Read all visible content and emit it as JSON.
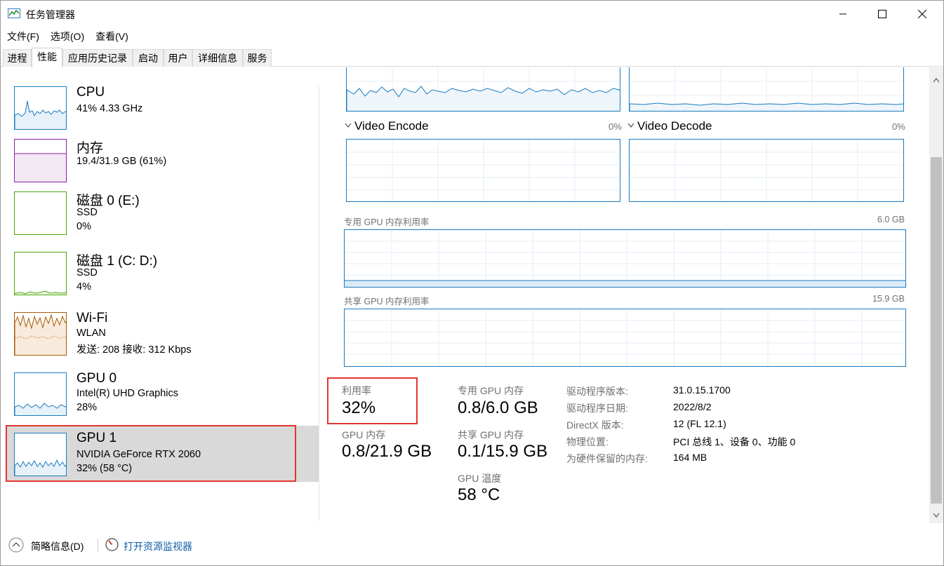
{
  "window": {
    "title": "任务管理器"
  },
  "menu": [
    "文件(F)",
    "选项(O)",
    "查看(V)"
  ],
  "tabs": [
    "进程",
    "性能",
    "应用历史记录",
    "启动",
    "用户",
    "详细信息",
    "服务"
  ],
  "sidebar": {
    "items": [
      {
        "title": "CPU",
        "line1": "41%  4.33 GHz",
        "line2": ""
      },
      {
        "title": "内存",
        "line1": "19.4/31.9 GB (61%)",
        "line2": ""
      },
      {
        "title": "磁盘 0 (E:)",
        "line1": "SSD",
        "line2": "0%"
      },
      {
        "title": "磁盘 1 (C: D:)",
        "line1": "SSD",
        "line2": "4%"
      },
      {
        "title": "Wi-Fi",
        "line1": "WLAN",
        "line2": "发送: 208 接收: 312 Kbps"
      },
      {
        "title": "GPU 0",
        "line1": "Intel(R) UHD Graphics",
        "line2": "28%"
      },
      {
        "title": "GPU 1",
        "line1": "NVIDIA GeForce RTX 2060",
        "line2": "32%  (58 °C)"
      }
    ]
  },
  "engines": {
    "encode": {
      "label": "Video Encode",
      "pct": "0%"
    },
    "decode": {
      "label": "Video Decode",
      "pct": "0%"
    }
  },
  "memory_graphs": {
    "dedicated": {
      "label": "专用 GPU 内存利用率",
      "max": "6.0 GB"
    },
    "shared": {
      "label": "共享 GPU 内存利用率",
      "max": "15.9 GB"
    }
  },
  "stats": {
    "utilization_label": "利用率",
    "utilization": "32%",
    "gpu_mem_label": "GPU 内存",
    "gpu_mem": "0.8/21.9 GB",
    "dedicated_label": "专用 GPU 内存",
    "dedicated": "0.8/6.0 GB",
    "shared_label": "共享 GPU 内存",
    "shared": "0.1/15.9 GB",
    "temp_label": "GPU 温度",
    "temp": "58 °C"
  },
  "info": [
    {
      "key": "驱动程序版本:",
      "value": "31.0.15.1700"
    },
    {
      "key": "驱动程序日期:",
      "value": "2022/8/2"
    },
    {
      "key": "DirectX 版本:",
      "value": "12 (FL 12.1)"
    },
    {
      "key": "物理位置:",
      "value": "PCI 总线 1、设备 0、功能 0"
    },
    {
      "key": "为硬件保留的内存:",
      "value": "164 MB"
    }
  ],
  "footer": {
    "summary": "简略信息(D)",
    "monitor": "打开资源监视器"
  },
  "colors": {
    "accent": "#1a7bbf",
    "highlight": "#e2352e",
    "memory": "#8b1fa8",
    "disk": "#4da60c",
    "wifi": "#a75a00"
  }
}
